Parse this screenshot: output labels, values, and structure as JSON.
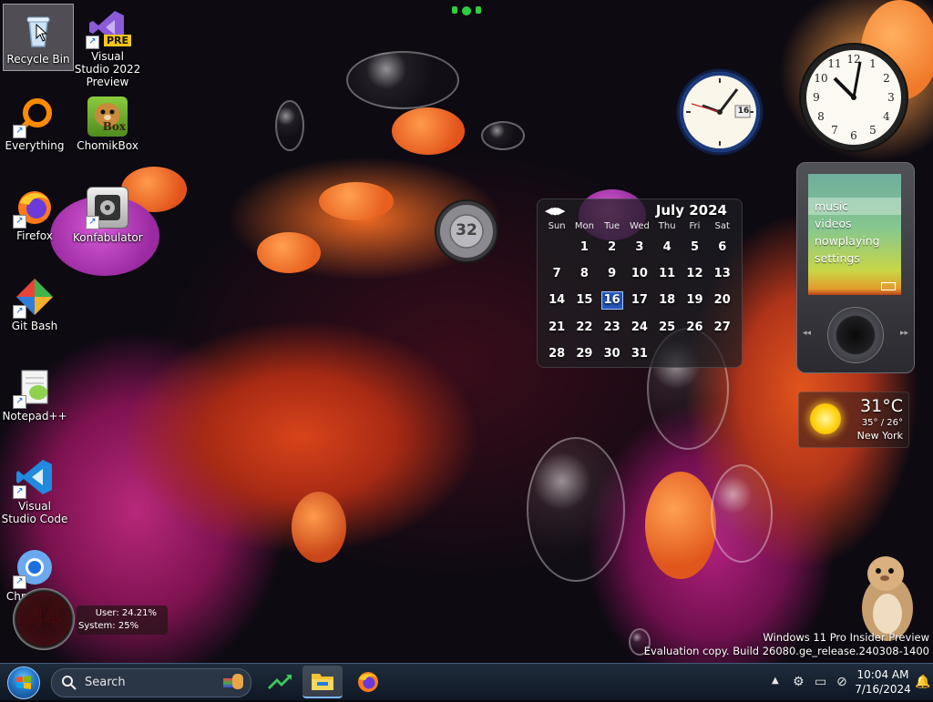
{
  "desktop": {
    "icons": [
      {
        "label": "Recycle Bin"
      },
      {
        "label": "Visual Studio 2022 Preview",
        "badge": "PRE"
      },
      {
        "label": "Everything"
      },
      {
        "label": "ChomikBox",
        "badge": "Box"
      },
      {
        "label": "Firefox"
      },
      {
        "label": "Konfabulator"
      },
      {
        "label": "Git Bash"
      },
      {
        "label": "Notepad++"
      },
      {
        "label": "Visual Studio Code"
      },
      {
        "label": "Chromium"
      }
    ]
  },
  "gadgets": {
    "clock_small": {
      "date": "16"
    },
    "volume_knob": {
      "value": "32"
    },
    "calendar": {
      "title": "July 2024",
      "weekdays": [
        "Sun",
        "Mon",
        "Tue",
        "Wed",
        "Thu",
        "Fri",
        "Sat"
      ],
      "days": [
        "",
        "1",
        "2",
        "3",
        "4",
        "5",
        "6",
        "7",
        "8",
        "9",
        "10",
        "11",
        "12",
        "13",
        "14",
        "15",
        "16",
        "17",
        "18",
        "19",
        "20",
        "21",
        "22",
        "23",
        "24",
        "25",
        "26",
        "27",
        "28",
        "29",
        "30",
        "31",
        "",
        "",
        ""
      ],
      "today": "16"
    },
    "zune": {
      "menu": [
        "music",
        "videos",
        "nowplaying",
        "settings"
      ],
      "selected": "music"
    },
    "weather": {
      "temp": "31°C",
      "range": "35° / 26°",
      "city": "New York"
    },
    "cpu_meter": {
      "value": "44",
      "user": "User: 24.21%",
      "system": "System: 25%"
    }
  },
  "watermark": {
    "line1": "Windows 11 Pro Insider Preview",
    "line2": "Evaluation copy. Build 26080.ge_release.240308-1400"
  },
  "taskbar": {
    "search_placeholder": "Search",
    "time": "10:04 AM",
    "date": "7/16/2024"
  },
  "colors": {
    "accent": "#2456b8",
    "taskbar": "#16212f"
  }
}
